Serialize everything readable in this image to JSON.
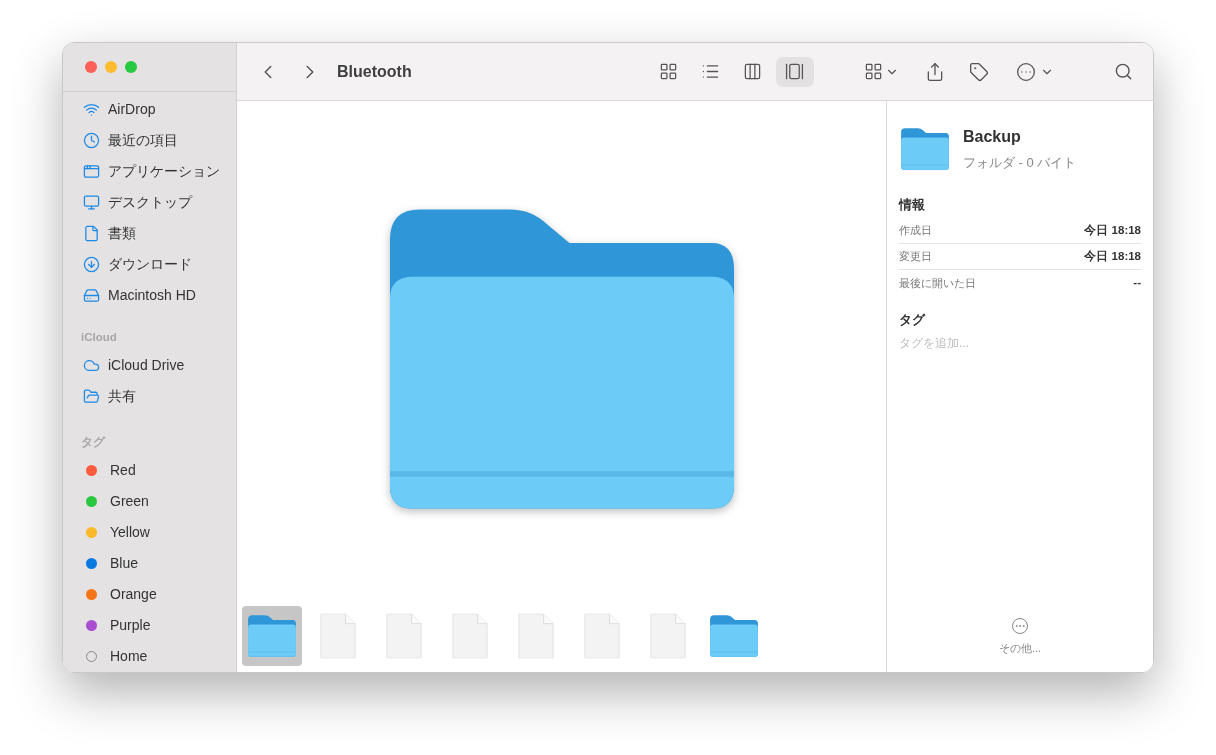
{
  "window": {
    "title": "Bluetooth"
  },
  "sidebar": {
    "sections": [
      {
        "items": [
          {
            "label": "AirDrop"
          },
          {
            "label": "最近の項目"
          },
          {
            "label": "アプリケーション"
          },
          {
            "label": "デスクトップ"
          },
          {
            "label": "書類"
          },
          {
            "label": "ダウンロード"
          },
          {
            "label": "Macintosh HD"
          }
        ]
      },
      {
        "heading": "iCloud",
        "items": [
          {
            "label": "iCloud Drive"
          },
          {
            "label": "共有"
          }
        ]
      }
    ],
    "tags": {
      "heading": "タグ",
      "items": [
        {
          "label": "Red",
          "color": "#fc5b3f",
          "kind": "filled"
        },
        {
          "label": "Green",
          "color": "#2ac840",
          "kind": "filled"
        },
        {
          "label": "Yellow",
          "color": "#fbb929",
          "kind": "filled"
        },
        {
          "label": "Blue",
          "color": "#0a7ae0",
          "kind": "filled"
        },
        {
          "label": "Orange",
          "color": "#f5761a",
          "kind": "filled"
        },
        {
          "label": "Purple",
          "color": "#a94ed1",
          "kind": "filled"
        },
        {
          "label": "Home",
          "color": "#8a8a8a",
          "kind": "outline"
        }
      ]
    }
  },
  "toolbar": {
    "views": [
      {
        "selected": false
      },
      {
        "selected": false
      },
      {
        "selected": false
      },
      {
        "selected": true
      }
    ]
  },
  "gallery": {
    "thumbnails": [
      {
        "kind": "folder",
        "selected": true
      },
      {
        "kind": "file",
        "selected": false
      },
      {
        "kind": "file",
        "selected": false
      },
      {
        "kind": "file",
        "selected": false
      },
      {
        "kind": "file",
        "selected": false
      },
      {
        "kind": "file",
        "selected": false
      },
      {
        "kind": "file",
        "selected": false
      },
      {
        "kind": "folder",
        "selected": false
      }
    ]
  },
  "inspector": {
    "name": "Backup",
    "subtitle": "フォルダ - 0 バイト",
    "info_heading": "情報",
    "rows": [
      {
        "label": "作成日",
        "value": "今日 18:18"
      },
      {
        "label": "変更日",
        "value": "今日 18:18"
      },
      {
        "label": "最後に開いた日",
        "value": "--"
      }
    ],
    "tags_heading": "タグ",
    "tags_placeholder": "タグを追加...",
    "more_label": "その他..."
  }
}
